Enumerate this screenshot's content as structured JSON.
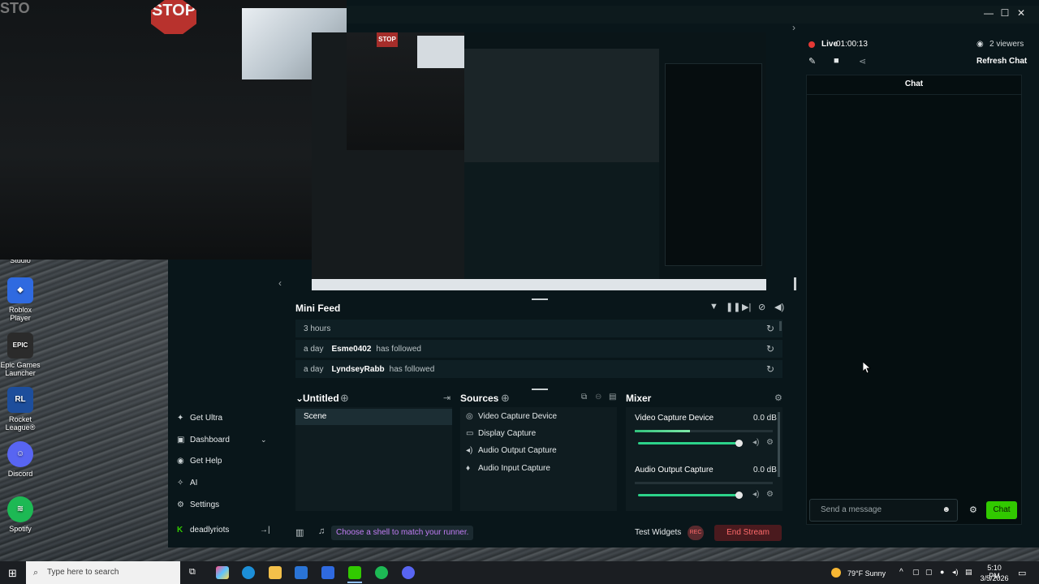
{
  "desktop": {
    "icons": [
      {
        "label": "Studio"
      },
      {
        "label": "Roblox Player"
      },
      {
        "label": "Epic Games Launcher"
      },
      {
        "label": "Rocket League®"
      },
      {
        "label": "Discord"
      },
      {
        "label": "Spotify"
      }
    ]
  },
  "webcam": {
    "stop_sign": "STOP",
    "stop_corner": "STO"
  },
  "stream": {
    "live_label": "Live",
    "live_time": "01:00:13",
    "viewers": "2 viewers",
    "refresh_chat": "Refresh Chat"
  },
  "mini_feed": {
    "title": "Mini Feed",
    "rows": [
      {
        "time": "3 hours",
        "who": "",
        "action": ""
      },
      {
        "time": "a day",
        "who": "Esme0402",
        "action": "has followed"
      },
      {
        "time": "a day",
        "who": "LyndseyRabb",
        "action": "has followed"
      }
    ]
  },
  "sidebar": {
    "items": [
      {
        "label": "Get Ultra",
        "icon": "sparkle-icon"
      },
      {
        "label": "Dashboard",
        "icon": "dashboard-icon"
      },
      {
        "label": "Get Help",
        "icon": "help-icon"
      },
      {
        "label": "AI",
        "icon": "ai-icon"
      },
      {
        "label": "Settings",
        "icon": "gear-icon"
      }
    ],
    "user": "deadlyriots"
  },
  "scenes": {
    "title": "Untitled",
    "items": [
      "Scene"
    ]
  },
  "sources": {
    "title": "Sources",
    "items": [
      {
        "label": "Video Capture Device",
        "icon": "webcam-icon"
      },
      {
        "label": "Display Capture",
        "icon": "monitor-icon"
      },
      {
        "label": "Audio Output Capture",
        "icon": "speaker-icon"
      },
      {
        "label": "Audio Input Capture",
        "icon": "mic-icon"
      }
    ]
  },
  "mixer": {
    "title": "Mixer",
    "channels": [
      {
        "name": "Video Capture Device",
        "db": "0.0 dB",
        "level": 0.4
      },
      {
        "name": "Audio Output Capture",
        "db": "0.0 dB",
        "level": 0.0
      }
    ]
  },
  "bottom_bar": {
    "hint": "Choose a shell to match your runner.",
    "test_widgets": "Test Widgets",
    "rec": "REC",
    "end_stream": "End Stream"
  },
  "chat": {
    "title": "Chat",
    "input_placeholder": "Send a message",
    "send_label": "Chat"
  },
  "taskbar": {
    "search_placeholder": "Type here to search",
    "weather": "79°F  Sunny",
    "time": "5:10 PM",
    "date": "3/5/2026"
  },
  "colors": {
    "accent_green": "#31c900",
    "live_red": "#e53935",
    "end_stream_red": "#ff6b6b",
    "hint_purple": "#c27df5"
  }
}
